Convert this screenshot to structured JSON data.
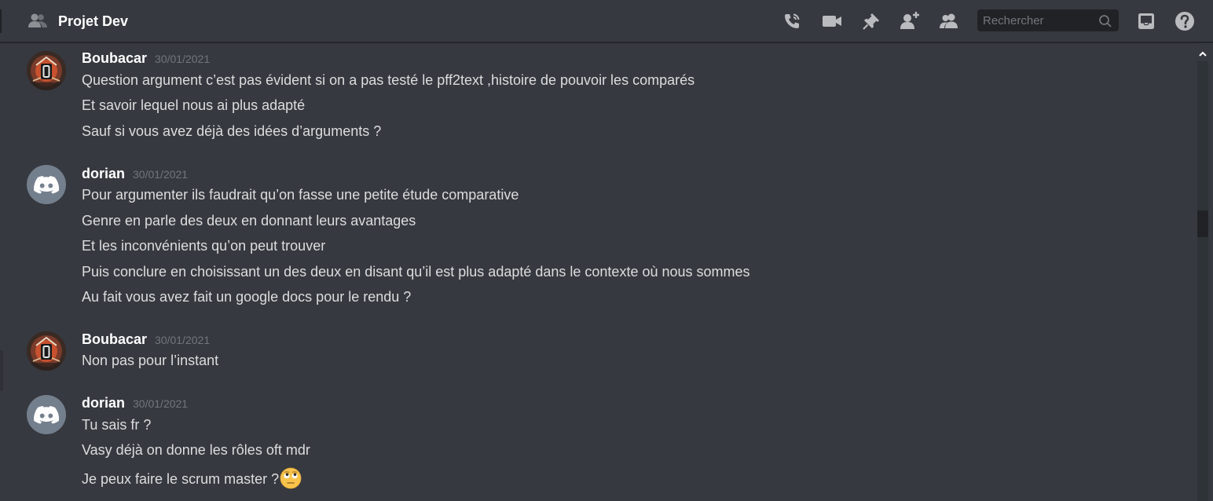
{
  "header": {
    "title": "Projet Dev",
    "channel_icon": "members-icon",
    "search_placeholder": "Rechercher",
    "toolbar_icons": [
      "call-icon",
      "video-icon",
      "pin-icon",
      "add-friend-icon",
      "members-icon",
      "search-icon",
      "inbox-icon",
      "help-icon"
    ]
  },
  "messages": [
    {
      "author": "Boubacar",
      "avatar": "boubacar-avatar",
      "timestamp": "30/01/2021",
      "lines": [
        "Question argument c’est pas évident si on a pas testé le pff2text ,histoire de pouvoir les comparés",
        "Et savoir lequel nous ai plus adapté",
        "Sauf si vous avez déjà des idées d’arguments ?"
      ]
    },
    {
      "author": "dorian",
      "avatar": "discord-default-avatar",
      "timestamp": "30/01/2021",
      "lines": [
        "Pour argumenter ils faudrait qu’on fasse une petite étude comparative",
        "Genre en parle des deux en donnant leurs avantages",
        "Et les inconvénients qu’on peut trouver",
        "Puis conclure en choisissant un des deux en disant qu’il est plus adapté dans le contexte où nous sommes",
        "Au fait vous avez fait un google docs pour le rendu ?"
      ]
    },
    {
      "author": "Boubacar",
      "avatar": "boubacar-avatar",
      "timestamp": "30/01/2021",
      "lines": [
        "Non pas pour l’instant"
      ]
    },
    {
      "author": "dorian",
      "avatar": "discord-default-avatar",
      "timestamp": "30/01/2021",
      "lines": [
        "Tu sais fr ?",
        "Vasy déjà on donne les rôles oft mdr",
        "Je peux faire le scrum master ?"
      ],
      "trailing_emoji": "face-with-rolling-eyes-emoji"
    }
  ],
  "colors": {
    "background": "#36393f",
    "header_border": "#202225",
    "text": "#dcddde",
    "username": "#ffffff",
    "timestamp": "#72767d",
    "discord_avatar_bg": "#747f8d"
  }
}
